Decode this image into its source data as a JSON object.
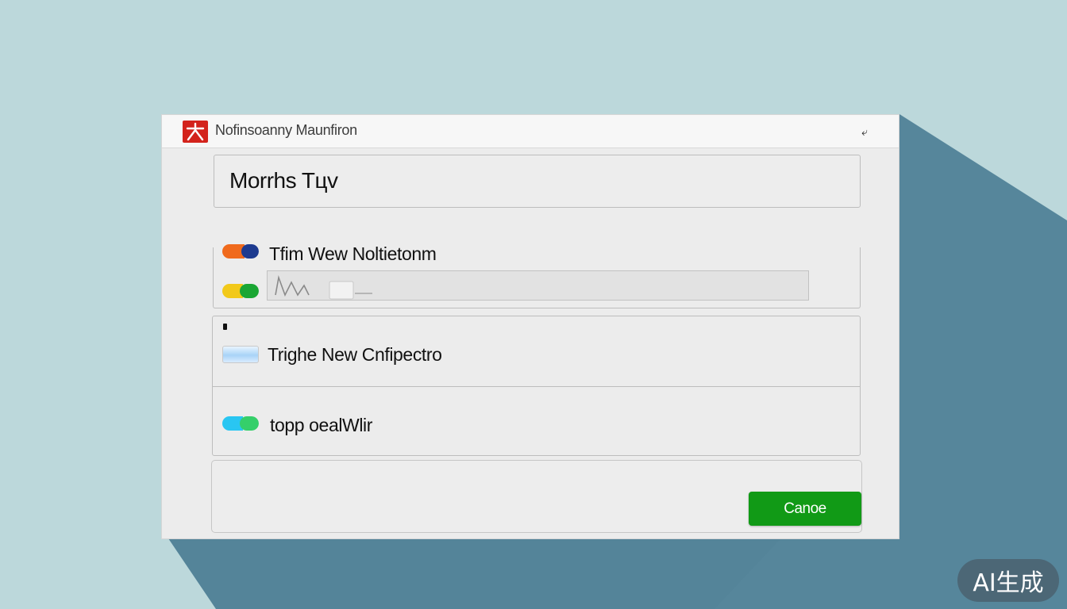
{
  "window": {
    "title": "Nofinsoanny Maunfiron",
    "back_glyph": "⤶"
  },
  "main": {
    "input_value": "Morrhs Tцv",
    "rows": [
      {
        "label": "Tfim Wew Noltietonm"
      },
      {
        "label": "Trighe New Cnfipectro"
      },
      {
        "label": "topp oealWlir"
      }
    ],
    "wave_text": "MvV"
  },
  "footer": {
    "button_label": "Canoe"
  },
  "watermark": {
    "text": "AI生成"
  },
  "colors": {
    "background": "#bcd8db",
    "shadow": "#4e7f96",
    "accent_green": "#119a16",
    "logo_red": "#d3231c",
    "toggle1_a": "#f06a1c",
    "toggle1_b": "#1d3a8f",
    "toggle2_a": "#f2c91a",
    "toggle2_b": "#1aa633",
    "toggle3_a": "#29c6f2",
    "toggle3_b": "#35cf6a"
  },
  "icons": {
    "logo": "red-square-logo-icon",
    "back": "back-arrow-icon",
    "toggle": "toggle-switch-icon",
    "chip": "blue-chip-icon"
  }
}
